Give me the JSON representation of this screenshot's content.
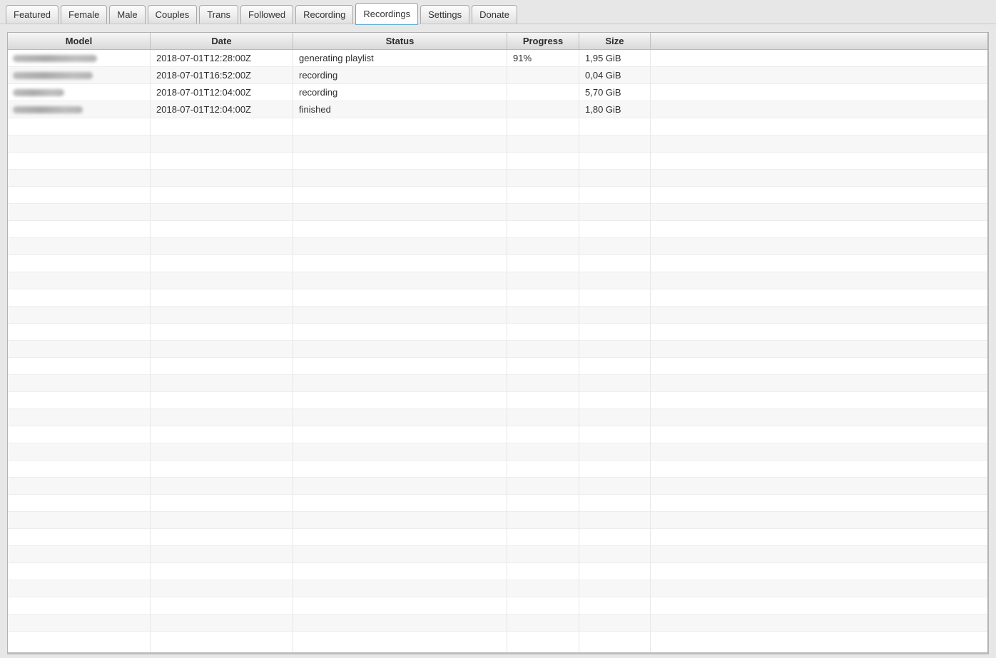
{
  "colors": {
    "accent_tab_border": "#62aed6",
    "stripe_row": "#f7f7f7",
    "page_background": "#e7e7e7"
  },
  "tabs": {
    "items": [
      {
        "label": "Featured",
        "active": false
      },
      {
        "label": "Female",
        "active": false
      },
      {
        "label": "Male",
        "active": false
      },
      {
        "label": "Couples",
        "active": false
      },
      {
        "label": "Trans",
        "active": false
      },
      {
        "label": "Followed",
        "active": false
      },
      {
        "label": "Recording",
        "active": false
      },
      {
        "label": "Recordings",
        "active": true
      },
      {
        "label": "Settings",
        "active": false
      },
      {
        "label": "Donate",
        "active": false
      }
    ]
  },
  "table": {
    "columns": [
      {
        "key": "model",
        "label": "Model"
      },
      {
        "key": "date",
        "label": "Date"
      },
      {
        "key": "status",
        "label": "Status"
      },
      {
        "key": "progress",
        "label": "Progress"
      },
      {
        "key": "size",
        "label": "Size"
      },
      {
        "key": "extra",
        "label": ""
      }
    ],
    "rows": [
      {
        "model": "",
        "model_censored": true,
        "model_blur_width": 118,
        "date": "2018-07-01T12:28:00Z",
        "status": "generating playlist",
        "progress": "91%",
        "size": "1,95 GiB"
      },
      {
        "model": "",
        "model_censored": true,
        "model_blur_width": 112,
        "date": "2018-07-01T16:52:00Z",
        "status": "recording",
        "progress": "",
        "size": "0,04 GiB"
      },
      {
        "model": "",
        "model_censored": true,
        "model_blur_width": 72,
        "date": "2018-07-01T12:04:00Z",
        "status": "recording",
        "progress": "",
        "size": "5,70 GiB"
      },
      {
        "model": "",
        "model_censored": true,
        "model_blur_width": 98,
        "date": "2018-07-01T12:04:00Z",
        "status": "finished",
        "progress": "",
        "size": "1,80 GiB"
      }
    ],
    "empty_row_count": 30
  }
}
